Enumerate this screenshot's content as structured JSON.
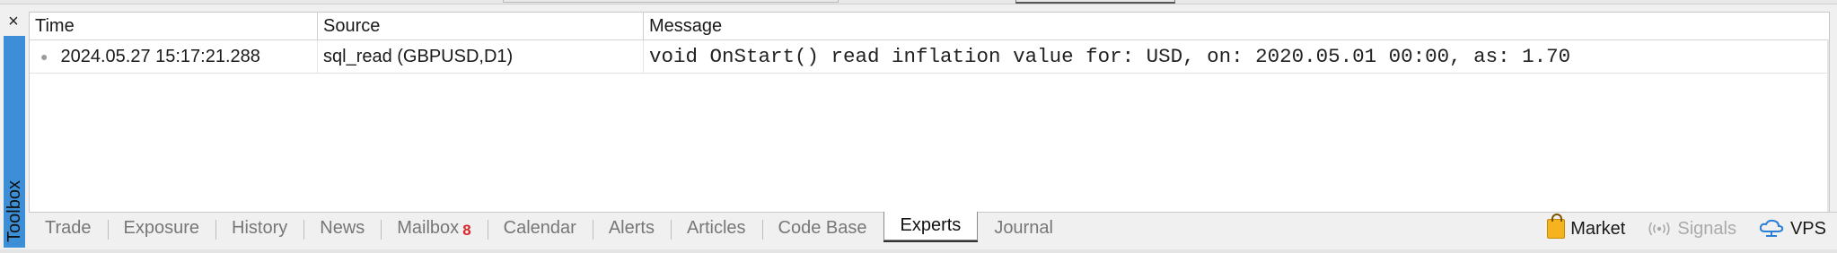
{
  "toolbox": {
    "close_glyph": "×",
    "label": "Toolbox",
    "accent_color": "#3c8fd6"
  },
  "log": {
    "columns": {
      "time": "Time",
      "source": "Source",
      "message": "Message"
    },
    "rows": [
      {
        "time": "2024.05.27 15:17:21.288",
        "source": "sql_read (GBPUSD,D1)",
        "message": "void OnStart() read inflation value for: USD, on: 2020.05.01 00:00, as: 1.70"
      }
    ]
  },
  "tabs": {
    "items": [
      {
        "label": "Trade"
      },
      {
        "label": "Exposure"
      },
      {
        "label": "History"
      },
      {
        "label": "News"
      },
      {
        "label": "Mailbox",
        "badge": "8"
      },
      {
        "label": "Calendar"
      },
      {
        "label": "Alerts"
      },
      {
        "label": "Articles"
      },
      {
        "label": "Code Base"
      },
      {
        "label": "Experts",
        "active": true
      },
      {
        "label": "Journal"
      }
    ],
    "active": "Experts"
  },
  "right_tools": {
    "market": "Market",
    "signals": "Signals",
    "vps": "VPS"
  },
  "colors": {
    "badge": "#d9262c",
    "market_icon": "#f5b41e",
    "vps_icon": "#2b7fd4"
  }
}
